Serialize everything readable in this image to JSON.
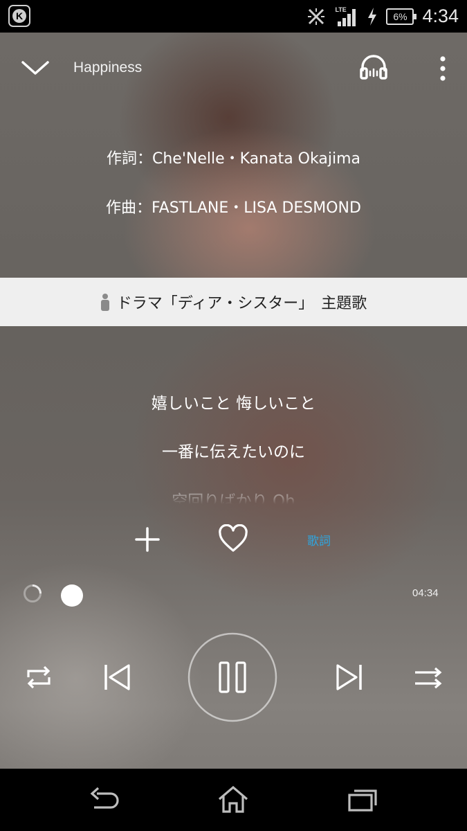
{
  "status_bar": {
    "app_icon_letter": "K",
    "network": "LTE",
    "battery": "6%",
    "time": "4:34"
  },
  "header": {
    "song_title": "Happiness",
    "collapse_icon": "chevron-down-icon",
    "headphone_icon": "headphones-icon",
    "more_icon": "more-vert-icon"
  },
  "credits": {
    "lyricist": "作詞：Che'Nelle・Kanata Okajima",
    "composer": "作曲：FASTLANE・LISA DESMOND"
  },
  "banner": {
    "text": "ドラマ「ディア・シスター」　主題歌",
    "icon": "person-icon"
  },
  "lyrics": [
    "嬉しいこと 悔しいこと",
    "一番に伝えたいのに",
    "空回りばかり Oh"
  ],
  "actions": {
    "add_icon": "plus-icon",
    "like_icon": "heart-icon",
    "lyrics_label": "歌詞",
    "accent_color": "#2ea6e0"
  },
  "progress": {
    "duration": "04:34",
    "position_fraction": 0.0
  },
  "controls": {
    "repeat_icon": "repeat-icon",
    "prev_icon": "skip-previous-icon",
    "play_state_icon": "pause-icon",
    "next_icon": "skip-next-icon",
    "shuffle_icon": "shuffle-icon"
  },
  "nav_bar": {
    "back_icon": "back-icon",
    "home_icon": "home-icon",
    "recents_icon": "recents-icon"
  }
}
